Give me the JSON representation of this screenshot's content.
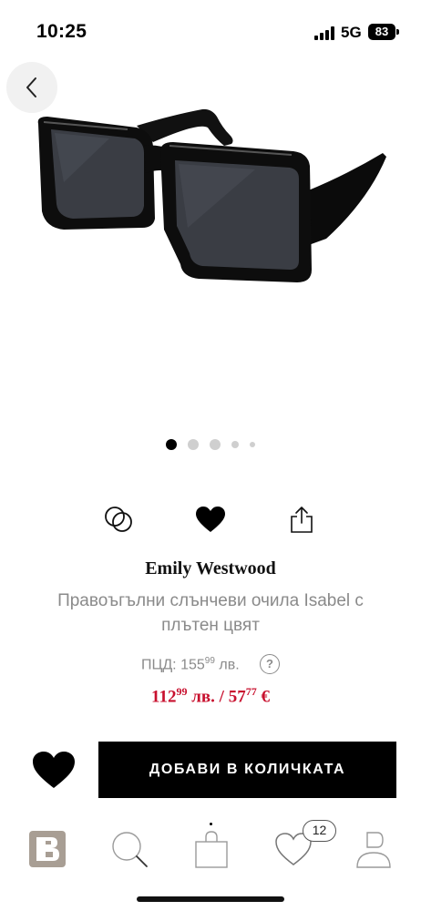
{
  "status_bar": {
    "time": "10:25",
    "network": "5G",
    "battery": "83"
  },
  "navigation": {
    "back_icon": "chevron-left-icon"
  },
  "gallery": {
    "image_description": "black rectangular sunglasses",
    "total_images": 5,
    "active_index": 0
  },
  "actions": {
    "compare_icon": "compare-circles-icon",
    "wishlist_icon": "heart-filled-icon",
    "share_icon": "share-icon"
  },
  "product": {
    "brand": "Emily Westwood",
    "name": "Правоъгълни слънчеви очила Isabel с плътен цвят",
    "rrp_label": "ПЦД:",
    "rrp_whole": "155",
    "rrp_cents": "99",
    "rrp_currency": "лв.",
    "price_bgn_whole": "112",
    "price_bgn_cents": "99",
    "price_bgn_currency": "лв.",
    "price_separator": "/",
    "price_eur_whole": "57",
    "price_eur_cents": "77",
    "price_eur_currency": "€",
    "price_color": "#c8102e"
  },
  "buy_bar": {
    "add_to_cart_label": "ДОБАВИ В КОЛИЧКАТА"
  },
  "bottom_nav": {
    "items": [
      {
        "name": "home",
        "icon": "brand-logo-icon"
      },
      {
        "name": "search",
        "icon": "search-icon"
      },
      {
        "name": "cart",
        "icon": "shopping-bag-icon"
      },
      {
        "name": "wishlist",
        "icon": "heart-outline-icon"
      },
      {
        "name": "profile",
        "icon": "user-icon"
      }
    ],
    "wishlist_count": "12"
  }
}
